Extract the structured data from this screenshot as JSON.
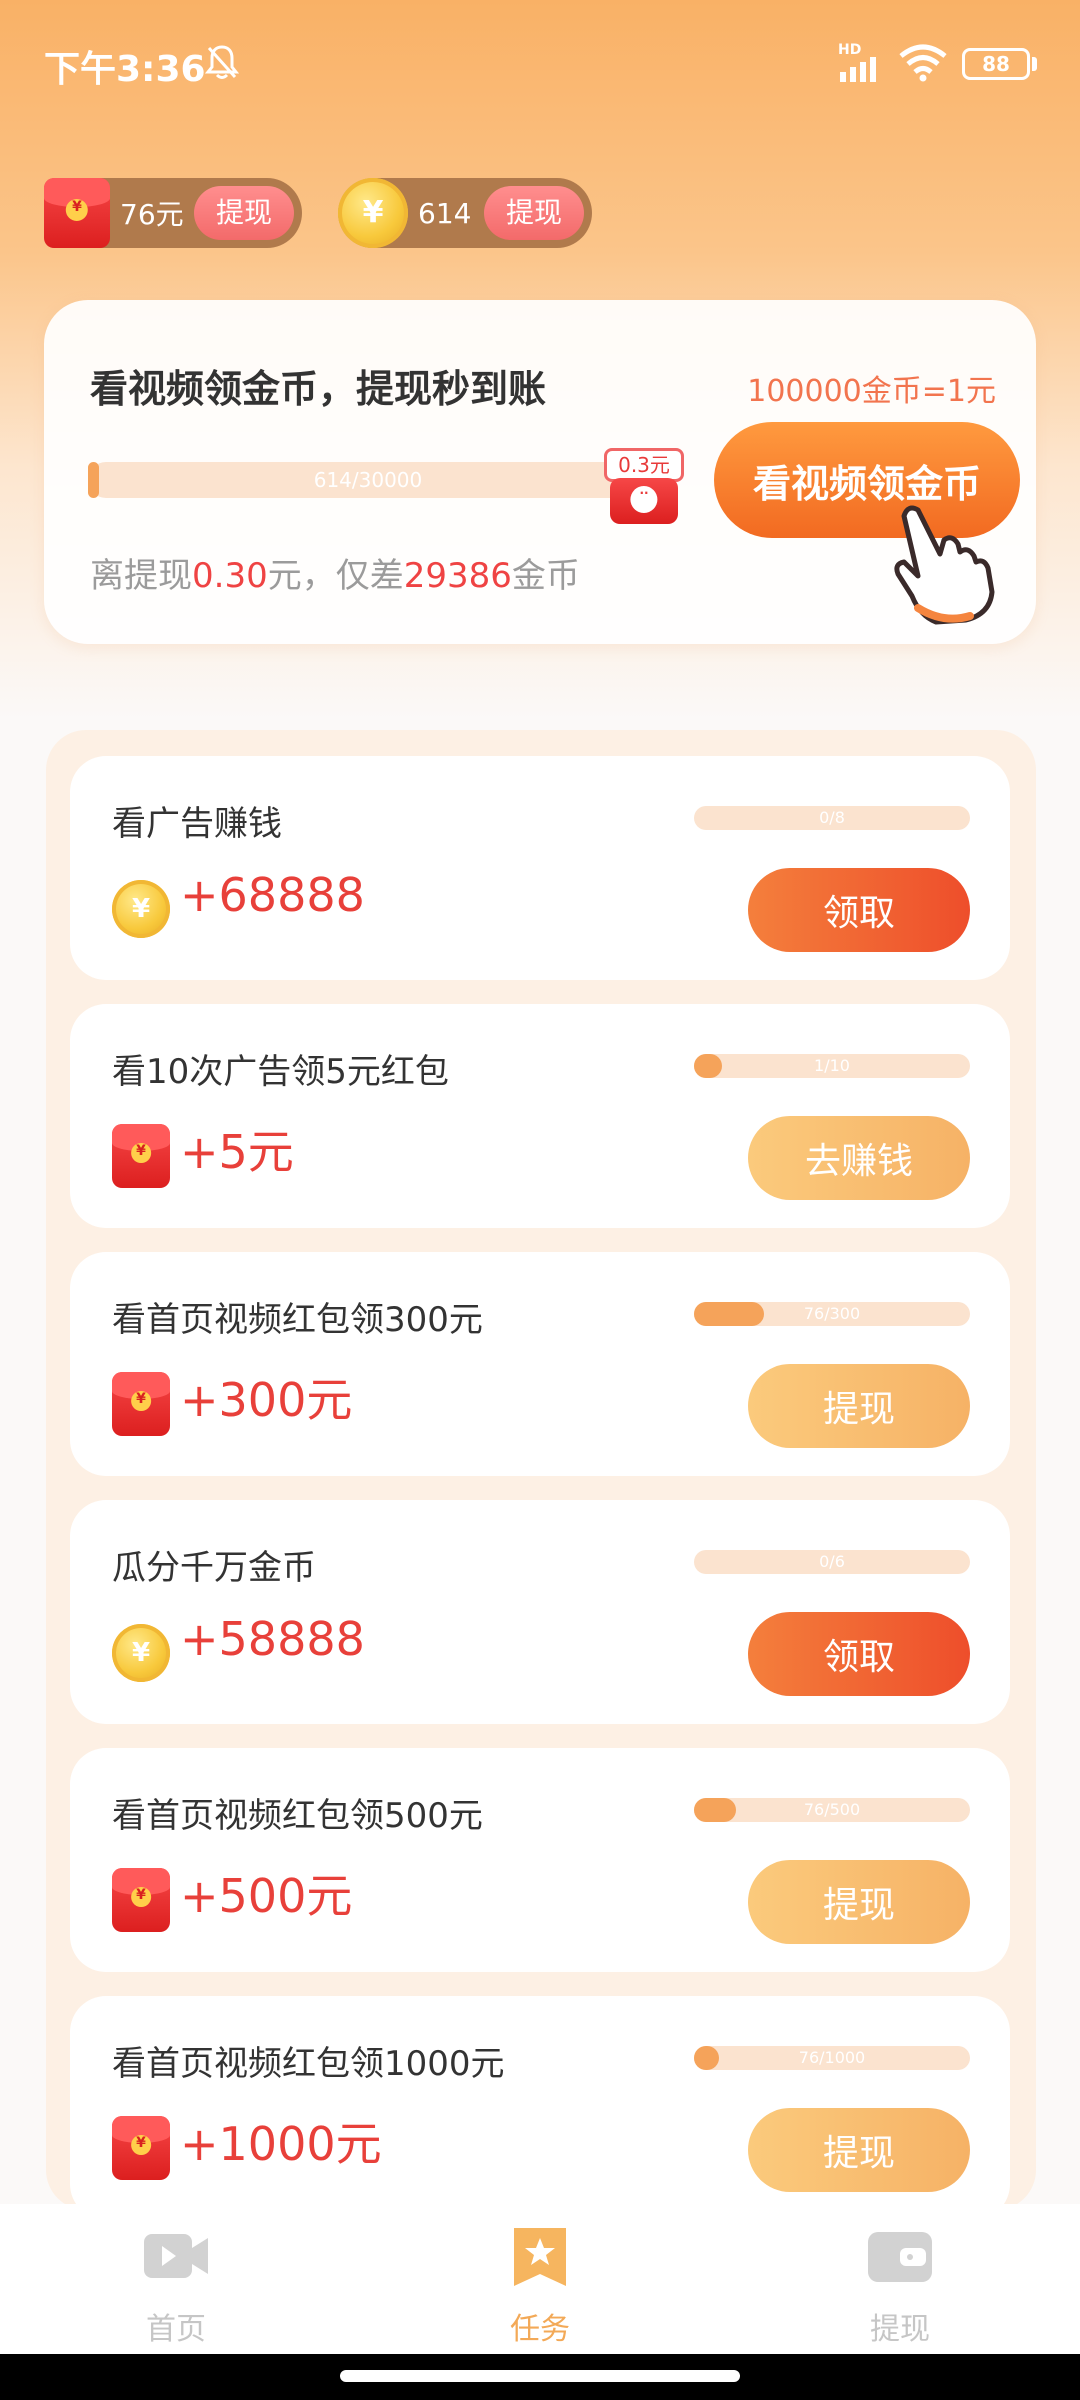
{
  "status": {
    "time": "下午3:36",
    "hd": "HD",
    "battery": "88"
  },
  "balances": {
    "cash": {
      "amount": "76元",
      "button": "提现"
    },
    "coins": {
      "amount": "614",
      "button": "提现"
    }
  },
  "promo": {
    "title": "看视频领金币，提现秒到账",
    "rate": "100000金币=1元",
    "progress_label": "614/30000",
    "progress_fraction": 0.02,
    "bubble_amount": "0.3元",
    "watch_button": "看视频领金币",
    "gap_prefix": "离提现",
    "gap_amount": "0.30",
    "gap_middle": "元，仅差",
    "gap_coins": "29386",
    "gap_suffix": "金币"
  },
  "tasks": [
    {
      "title": "看广告赚钱",
      "reward": "+68888",
      "icon": "coin-icon",
      "progress": "0/8",
      "fraction": 0.0,
      "button": "领取",
      "style": "strong"
    },
    {
      "title": "看10次广告领5元红包",
      "reward": "+5元",
      "icon": "red-packet-icon",
      "progress": "1/10",
      "fraction": 0.1,
      "button": "去赚钱",
      "style": "light"
    },
    {
      "title": "看首页视频红包领300元",
      "reward": "+300元",
      "icon": "red-packet-icon",
      "progress": "76/300",
      "fraction": 0.253,
      "button": "提现",
      "style": "light"
    },
    {
      "title": "瓜分千万金币",
      "reward": "+58888",
      "icon": "coin-icon",
      "progress": "0/6",
      "fraction": 0.0,
      "button": "领取",
      "style": "strong"
    },
    {
      "title": "看首页视频红包领500元",
      "reward": "+500元",
      "icon": "red-packet-icon",
      "progress": "76/500",
      "fraction": 0.152,
      "button": "提现",
      "style": "light"
    },
    {
      "title": "看首页视频红包领1000元",
      "reward": "+1000元",
      "icon": "red-packet-icon",
      "progress": "76/1000",
      "fraction": 0.076,
      "button": "提现",
      "style": "light"
    }
  ],
  "nav": [
    {
      "label": "首页",
      "icon": "video-icon",
      "active": false
    },
    {
      "label": "任务",
      "icon": "task-star-icon",
      "active": true
    },
    {
      "label": "提现",
      "icon": "wallet-icon",
      "active": false
    }
  ],
  "colors": {
    "accent": "#f26a21",
    "reward": "#e8403a",
    "nav_active": "#f3a957"
  }
}
